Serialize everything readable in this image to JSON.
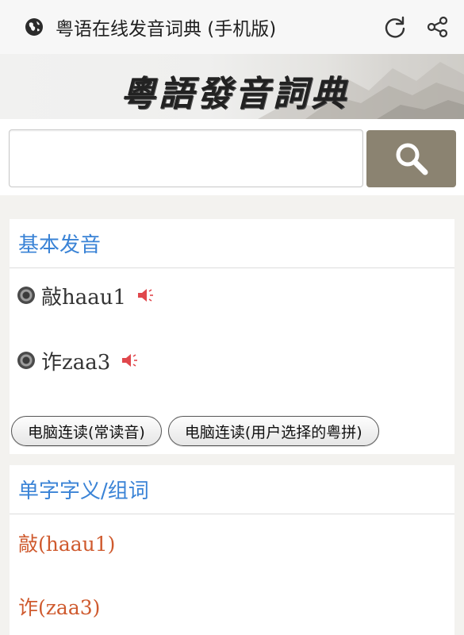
{
  "app_bar": {
    "title": "粤语在线发音词典 (手机版)",
    "icons": [
      "globe-icon",
      "refresh-icon",
      "share-icon"
    ]
  },
  "banner": {
    "calligraphy_text": "粵語發音詞典"
  },
  "search": {
    "value": "",
    "placeholder": "",
    "button_icon": "search-icon",
    "button_color": "#8b8371"
  },
  "basic_pronunciation": {
    "heading": "基本发音",
    "items": [
      {
        "char": "敲",
        "romanization": "haau1"
      },
      {
        "char": "诈",
        "romanization": "zaa3"
      }
    ],
    "buttons": [
      "电脑连读(常读音)",
      "电脑连读(用户选择的粤拼)"
    ]
  },
  "word_meaning": {
    "heading": "单字字义/组词",
    "links": [
      "敲(haau1)",
      "诈(zaa3)"
    ]
  },
  "colors": {
    "heading_blue": "#3a83d6",
    "link_orange": "#cf5a2e",
    "speaker_red": "#e0474c"
  }
}
